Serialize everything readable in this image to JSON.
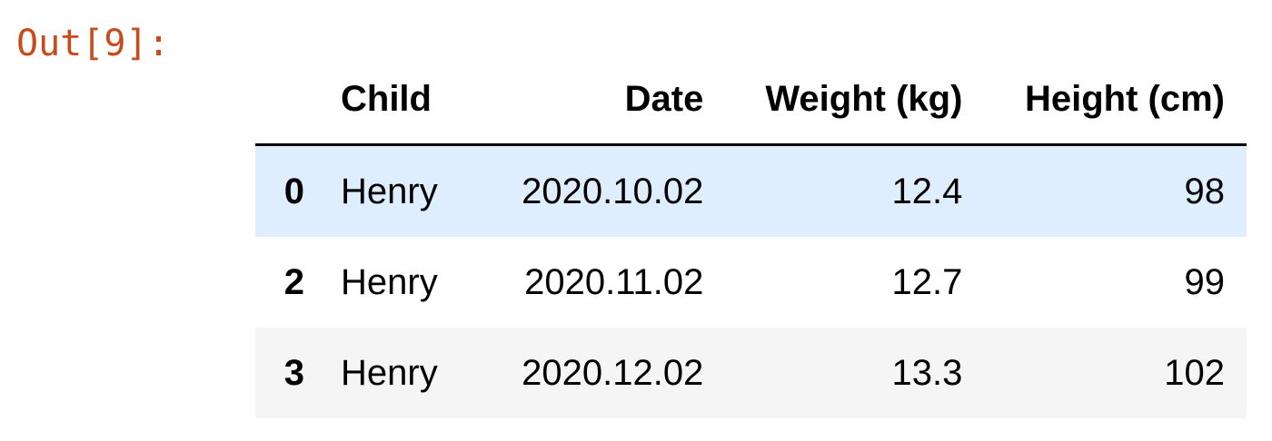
{
  "cell": {
    "prompt": "Out[9]:"
  },
  "table": {
    "index_header": "",
    "columns": [
      "Child",
      "Date",
      "Weight (kg)",
      "Height (cm)"
    ],
    "rows": [
      {
        "index": "0",
        "child": "Henry",
        "date": "2020.10.02",
        "weight": "12.4",
        "height": "98",
        "style": "hover"
      },
      {
        "index": "2",
        "child": "Henry",
        "date": "2020.11.02",
        "weight": "12.7",
        "height": "99",
        "style": "plain"
      },
      {
        "index": "3",
        "child": "Henry",
        "date": "2020.12.02",
        "weight": "13.3",
        "height": "102",
        "style": "striped"
      }
    ]
  },
  "colors": {
    "prompt": "#c94a1a",
    "hover_row": "#dfeeff",
    "striped_row": "#f5f5f5",
    "header_border": "#000000"
  }
}
